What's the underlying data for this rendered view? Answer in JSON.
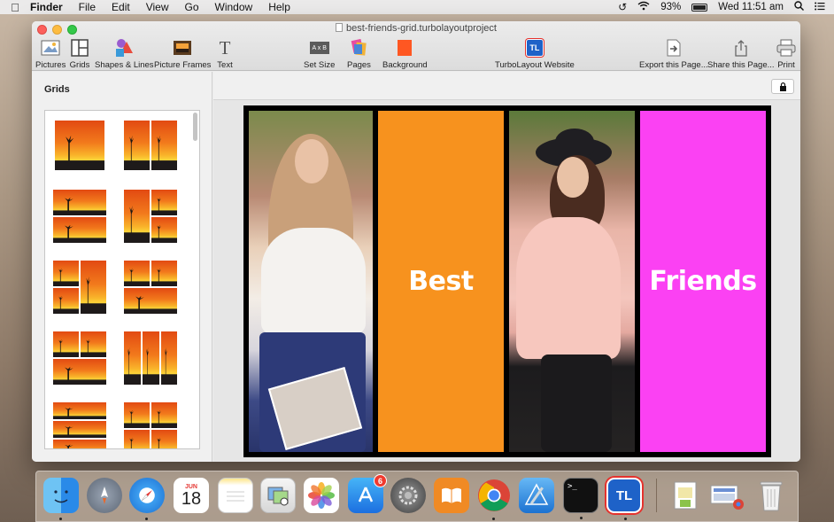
{
  "menubar": {
    "apple": "",
    "items": [
      "Finder",
      "File",
      "Edit",
      "View",
      "Go",
      "Window",
      "Help"
    ],
    "battery": "93%",
    "clock": "Wed 11:51 am"
  },
  "window": {
    "title": "best-friends-grid.turbolayoutproject",
    "toolbar": {
      "pictures": "Pictures",
      "grids": "Grids",
      "shapes": "Shapes & Lines",
      "frames": "Picture Frames",
      "text": "Text",
      "set_size": "Set Size",
      "set_size_icon": "A x B",
      "pages": "Pages",
      "background": "Background",
      "website": "TurboLayout Website",
      "website_icon": "TL",
      "export": "Export this Page...",
      "share": "Share this Page...",
      "print": "Print"
    }
  },
  "sidebar": {
    "heading": "Grids"
  },
  "canvas": {
    "panel2_text": "Best",
    "panel4_text": "Friends",
    "colors": {
      "orange": "#f7921e",
      "magenta": "#fb41f3"
    }
  },
  "dock": {
    "calendar_month": "JUN",
    "calendar_day": "18",
    "appstore_badge": "6",
    "turbolayout_label": "TL",
    "terminal_prompt": ">_"
  }
}
